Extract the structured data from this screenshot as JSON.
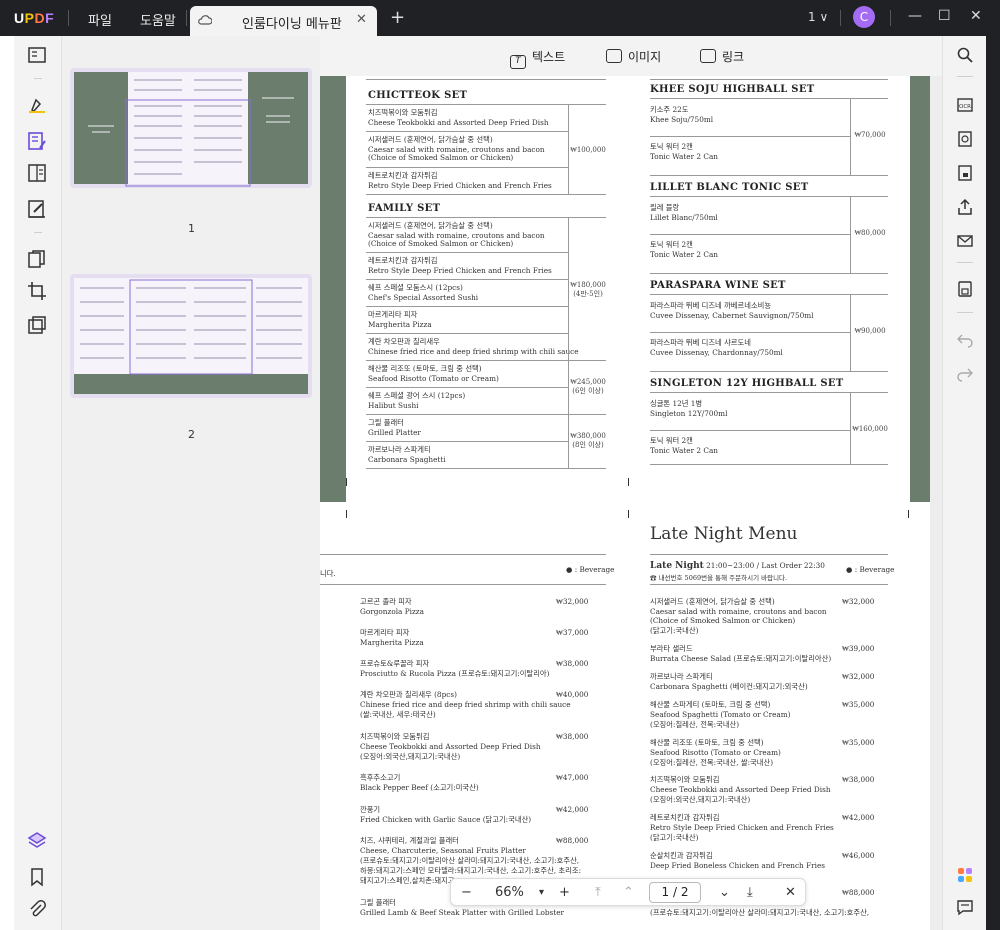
{
  "app": {
    "logo": "UPDF"
  },
  "menu": {
    "file": "파일",
    "help": "도움말"
  },
  "tab": {
    "title": "인룸다이닝 메뉴판",
    "close": "✕",
    "new": "+"
  },
  "topright": {
    "version": "1 ∨",
    "avatar": "C"
  },
  "window": {
    "minimize": "—",
    "maximize": "☐",
    "close": "✕"
  },
  "toolbar": {
    "text": "텍스트",
    "image": "이미지",
    "link": "링크"
  },
  "thumbnails": [
    {
      "number": "1"
    },
    {
      "number": "2"
    }
  ],
  "page1": {
    "left": {
      "sections": [
        {
          "title": "CHICTTEOK SET",
          "items": [
            {
              "ko": "치즈떡볶이와 모둠튀김",
              "en": "Cheese Teokbokki and Assorted Deep Fried Dish"
            },
            {
              "ko": "시저샐러드 (훈제연어, 닭가슴살 중 선택)",
              "en": "Caesar salad with romaine, croutons and bacon",
              "en2": "(Choice of Smoked Salmon or Chicken)"
            },
            {
              "ko": "레트로치킨과 감자튀김",
              "en": "Retro Style Deep Fried Chicken and French Fries"
            }
          ],
          "price": "₩100,000"
        },
        {
          "title": "FAMILY SET",
          "items": [
            {
              "ko": "시저샐러드 (훈제연어, 닭가슴살 중 선택)",
              "en": "Caesar salad with romaine, croutons and bacon",
              "en2": "(Choice of Smoked Salmon or Chicken)"
            },
            {
              "ko": "레트로치킨과 감자튀김",
              "en": "Retro Style Deep Fried Chicken and French Fries"
            },
            {
              "ko": "쉐프 스페셜 모둠스시 (12pcs)",
              "en": "Chef's Special Assorted Sushi"
            },
            {
              "ko": "마르게리타 피자",
              "en": "Margherita Pizza"
            },
            {
              "ko": "계란 차오판과 칠리새우",
              "en": "Chinese fried rice and deep fried shrimp with chili sauce"
            },
            {
              "ko": "해산물 리조또 (토마토, 크림 중 선택)",
              "en": "Seafood Risotto (Tomato or Cream)"
            },
            {
              "ko": "쉐프 스페셜 광어 스시 (12pcs)",
              "en": "Halibut Sushi"
            },
            {
              "ko": "그릴 플래터",
              "en": "Grilled Platter"
            },
            {
              "ko": "까르보나라 스파게티",
              "en": "Carbonara Spaghetti"
            }
          ],
          "prices": [
            {
              "price": "₩180,000",
              "note": "(4만-5인)"
            },
            {
              "price": "₩245,000",
              "note": "(6인 이상)"
            },
            {
              "price": "₩380,000",
              "note": "(8인 이상)"
            }
          ]
        }
      ]
    },
    "right": {
      "sections": [
        {
          "title": "KHEE SOJU HIGHBALL SET",
          "items": [
            {
              "ko": "키소주 22도",
              "en": "Khee Soju/750ml"
            },
            {
              "ko": "토닉 워터 2캔",
              "en": "Tonic Water 2 Can"
            }
          ],
          "price": "₩70,000"
        },
        {
          "title": "LILLET BLANC TONIC SET",
          "items": [
            {
              "ko": "릴레 블랑",
              "en": "Lillet Blanc/750ml"
            },
            {
              "ko": "토닉 워터 2캔",
              "en": "Tonic Water 2 Can"
            }
          ],
          "price": "₩80,000"
        },
        {
          "title": "PARASPARA WINE SET",
          "items": [
            {
              "ko": "파라스파라 뛰베 디즈네 까베르네소비뇽",
              "en": "Cuvee Dissenay, Cabernet Sauvignon/750ml"
            },
            {
              "ko": "파라스파라 뛰베 디즈네 샤르도네",
              "en": "Cuvee Dissenay, Chardonnay/750ml"
            }
          ],
          "price": "₩90,000"
        },
        {
          "title": "SINGLETON 12Y HIGHBALL SET",
          "items": [
            {
              "ko": "싱글톤 12년 1병",
              "en": "Singleton 12Y/700ml"
            },
            {
              "ko": "토닉 워터 2캔",
              "en": "Tonic Water 2 Can"
            }
          ],
          "price": "₩160,000"
        }
      ]
    }
  },
  "page2": {
    "left": {
      "note": "니다.",
      "beverage": "Beverage",
      "items": [
        {
          "ko": "고르곤 졸라 피자",
          "en": "Gorgonzola Pizza",
          "price": "₩32,000"
        },
        {
          "ko": "마르게리타 피자",
          "en": "Margherita Pizza",
          "price": "₩37,000"
        },
        {
          "ko": "프로슈토&루꼴라 피자",
          "en": "Prosciutto & Rucola Pizza (프로슈토:돼지고기:이탈리아)",
          "price": "₩38,000"
        },
        {
          "ko": "계란 차오판과 칠리새우 (8pcs)",
          "en": "Chinese fried rice and deep fried shrimp with chili sauce",
          "en2": "(쌀:국내산, 새우:태국산)",
          "price": "₩40,000"
        },
        {
          "ko": "치즈떡볶이와 모둠튀김",
          "en": "Cheese Teokbokki and Assorted Deep Fried Dish",
          "en2": "(오징어:외국산,돼지고기:국내산)",
          "price": "₩38,000"
        },
        {
          "ko": "흑후추소고기",
          "en": "Black Pepper Beef (소고기:미국산)",
          "price": "₩47,000"
        },
        {
          "ko": "깐풍기",
          "en": "Fried Chicken with Garlic Sauce (닭고기:국내산)",
          "price": "₩42,000"
        },
        {
          "ko": "치즈, 샤퀴테리, 계절과일 플래터",
          "en": "Cheese, Charcuterie, Seasonal Fruits Platter",
          "en2": "(프로슈토:돼지고기:이탈리아산 살라미:돼지고기:국내산, 소고기:호주산,",
          "en3": "하몽:돼지고기:스페인 모타델라:돼지고기:국내산, 소고기:호주산, 초리조:",
          "en4": "돼지고기:스페인,살치촌:돼지고",
          "price": "₩88,000"
        },
        {
          "ko": "그릴 플래터",
          "en": "Grilled Lamb & Beef Steak Platter with Grilled Lobster",
          "price": ""
        }
      ]
    },
    "right": {
      "title": "Late Night Menu",
      "subtitle_bold": "Late Night",
      "subtitle": "21:00~23:00 / Last Order 22:30",
      "note": "☎ 내선번호 5069번을 통해 주문하시기 바랍니다.",
      "beverage": "Beverage",
      "items": [
        {
          "ko": "시저샐러드 (훈제연어, 닭가슴살 중 선택)",
          "en": "Caesar salad with romaine, croutons and bacon",
          "en2": "(Choice of Smoked Salmon or Chicken)",
          "en3": "(닭고기:국내산)",
          "price": "₩32,000"
        },
        {
          "ko": "부라타 샐러드",
          "en": "Burrata Cheese Salad (프로슈토:돼지고기:이탈리아산)",
          "price": "₩39,000"
        },
        {
          "ko": "까르보나라 스파게티",
          "en": "Carbonara Spaghetti (베이컨:돼지고기:외국산)",
          "price": "₩32,000"
        },
        {
          "ko": "해산물 스파게티 (토마토, 크림 중 선택)",
          "en": "Seafood Spaghetti (Tomato or Cream)",
          "en2": "(오징어:칠레산, 전복:국내산)",
          "price": "₩35,000"
        },
        {
          "ko": "해산물 리조또 (토마토, 크림 중 선택)",
          "en": "Seafood Risotto (Tomato or Cream)",
          "en2": "(오징어:칠레산, 전복:국내산, 쌀:국내산)",
          "price": "₩35,000"
        },
        {
          "ko": "치즈떡볶이와 모둠튀김",
          "en": "Cheese Teokbokki and Assorted Deep Fried Dish",
          "en2": "(오징어:외국산,돼지고기:국내산)",
          "price": "₩38,000"
        },
        {
          "ko": "레트로치킨과 감자튀김",
          "en": "Retro Style Deep Fried Chicken and French Fries",
          "en2": "(닭고기:국내산)",
          "price": "₩42,000"
        },
        {
          "ko": "순살치킨과 감자튀김",
          "en": "Deep Fried Boneless Chicken and French Fries",
          "price": "₩46,000"
        },
        {
          "ko": "",
          "en": "(프로슈토:돼지고기:이탈리아산 살라미:돼지고기:국내산, 소고기:호주산,",
          "price": "₩88,000"
        }
      ]
    }
  },
  "zoom": {
    "minus": "−",
    "value": "66%",
    "caret": "▾",
    "plus": "+",
    "page": "1 / 2",
    "close": "✕"
  }
}
